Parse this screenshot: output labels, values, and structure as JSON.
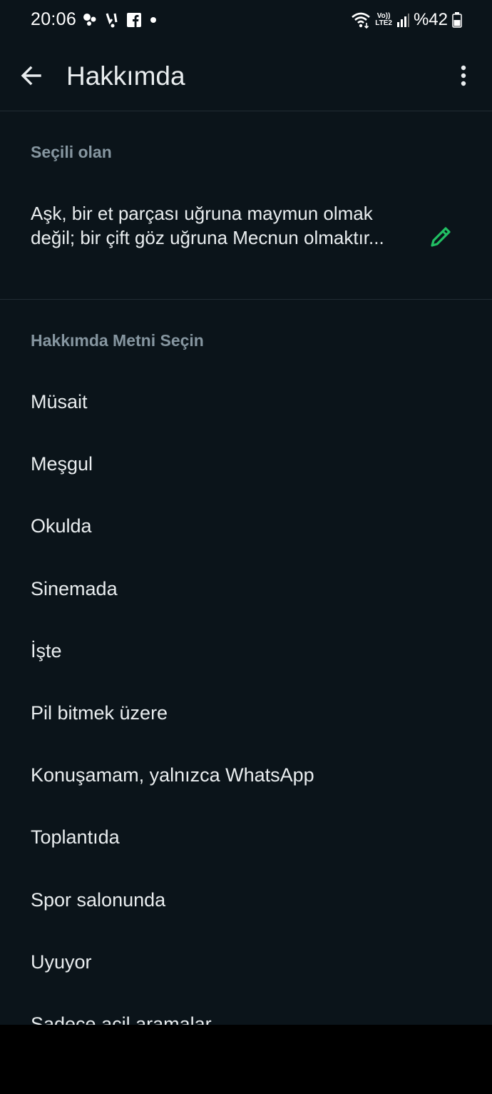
{
  "status_bar": {
    "time": "20:06",
    "battery": "%42",
    "lte_top": "Vo))",
    "lte_bottom": "LTE2",
    "icons": [
      "notification-dot-icon",
      "voicemail-icon",
      "facebook-icon",
      "dot-icon",
      "wifi-icon",
      "signal-icon",
      "battery-icon"
    ]
  },
  "header": {
    "title": "Hakkımda",
    "back_icon": "arrow-left-icon",
    "menu_icon": "more-vertical-icon"
  },
  "current": {
    "label": "Seçili olan",
    "text": "Aşk, bir et parçası uğruna maymun olmak değil; bir çift göz uğruna Mecnun olmaktır...",
    "edit_icon": "pencil-icon",
    "edit_color": "#21c063"
  },
  "options": {
    "label": "Hakkımda Metni Seçin",
    "items": [
      {
        "label": "Müsait"
      },
      {
        "label": "Meşgul"
      },
      {
        "label": "Okulda"
      },
      {
        "label": "Sinemada"
      },
      {
        "label": "İşte"
      },
      {
        "label": "Pil bitmek üzere"
      },
      {
        "label": "Konuşamam, yalnızca WhatsApp"
      },
      {
        "label": "Toplantıda"
      },
      {
        "label": "Spor salonunda"
      },
      {
        "label": "Uyuyor"
      },
      {
        "label": "Sadece acil aramalar"
      }
    ]
  },
  "colors": {
    "background": "#0b141a",
    "text_primary": "#e9edef",
    "text_secondary": "#8696a0",
    "accent": "#21c063",
    "divider": "#222d34"
  }
}
